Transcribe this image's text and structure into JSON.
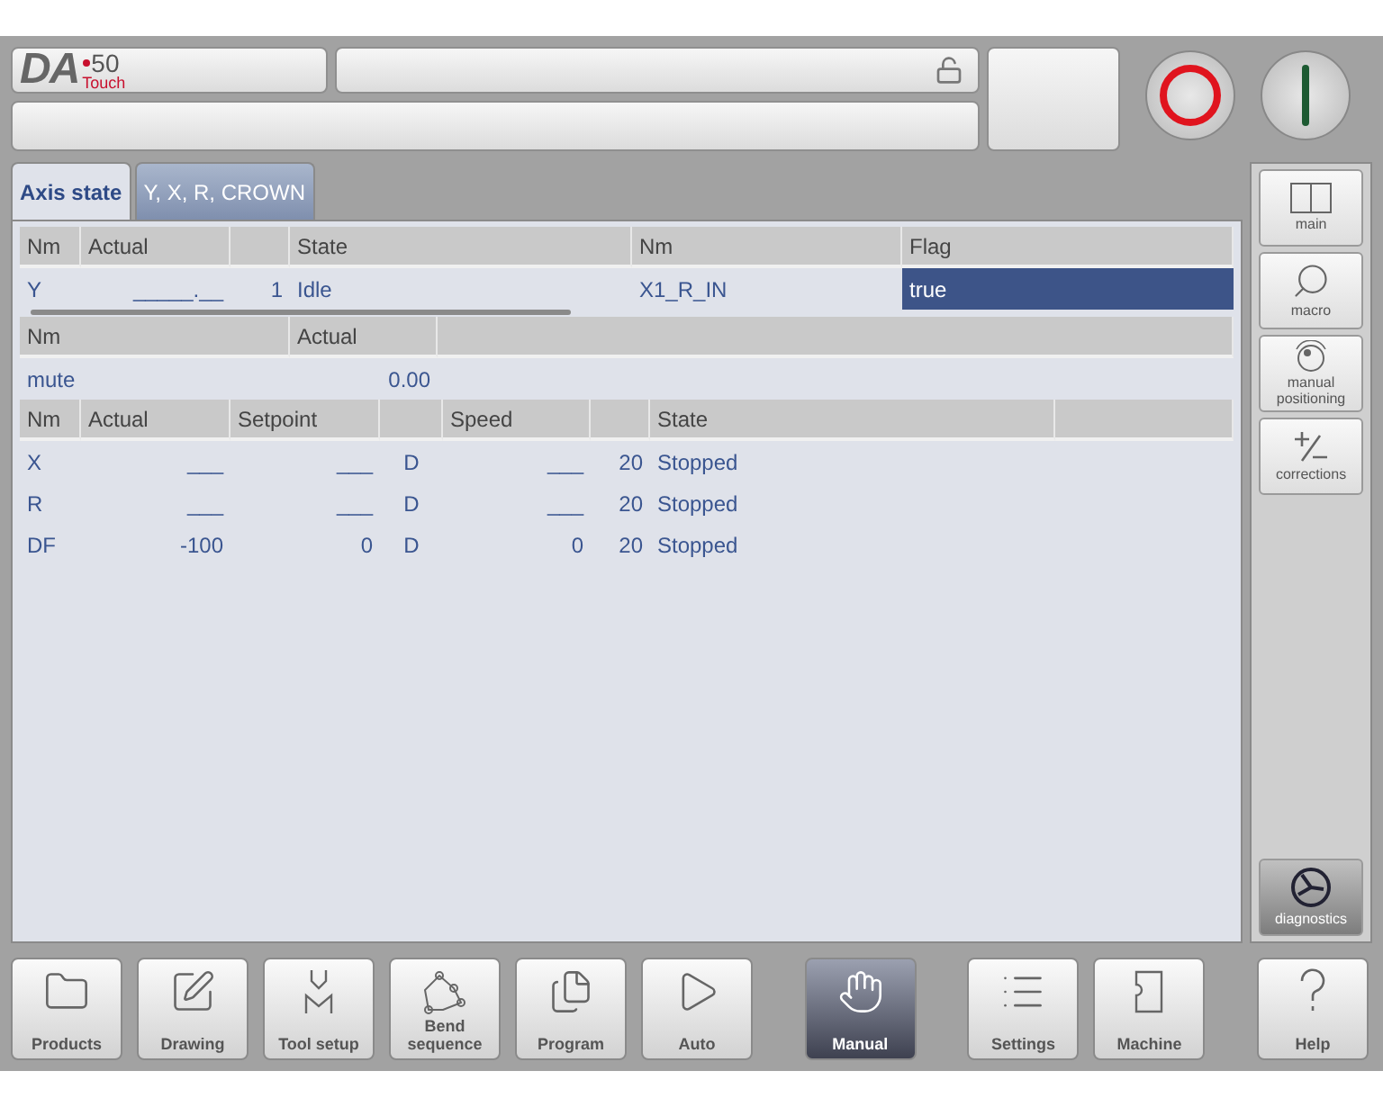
{
  "logo": {
    "brand": "DA",
    "model": "50",
    "edition": "Touch"
  },
  "header": {
    "locked": false
  },
  "tabs": [
    {
      "label": "Axis state",
      "selected": true
    },
    {
      "label": "Y, X, R, CROWN",
      "selected": false
    }
  ],
  "tables": [
    {
      "columns": [
        "Nm",
        "Actual",
        null,
        "State",
        "Nm",
        "Flag"
      ],
      "rows": [
        {
          "cells": [
            "Y",
            "_____.__",
            "1",
            "Idle",
            "X1_R_IN",
            {
              "text": "true",
              "selected": true
            }
          ]
        }
      ]
    },
    {
      "columns": [
        "Nm",
        "Actual",
        null
      ],
      "rows": [
        {
          "cells": [
            "mute",
            "0.00"
          ]
        }
      ]
    },
    {
      "columns": [
        "Nm",
        "Actual",
        "Setpoint",
        null,
        "Speed",
        null,
        "State",
        null
      ],
      "rows": [
        {
          "cells": [
            "X",
            "___",
            "___",
            "D",
            "___",
            "20",
            "Stopped"
          ]
        },
        {
          "cells": [
            "R",
            "___",
            "___",
            "D",
            "___",
            "20",
            "Stopped"
          ]
        },
        {
          "cells": [
            "DF",
            "-100",
            "0",
            "D",
            "0",
            "20",
            "Stopped"
          ]
        }
      ]
    }
  ],
  "side_buttons": [
    {
      "label": "main",
      "kind": "split",
      "selected": false
    },
    {
      "label": "macro",
      "kind": "search",
      "selected": false
    },
    {
      "label": "manual positioning",
      "kind": "knob",
      "selected": false
    },
    {
      "label": "corrections",
      "kind": "plusminus",
      "selected": false
    }
  ],
  "side_bottom": {
    "label": "diagnostics",
    "kind": "wheel",
    "selected": true
  },
  "nav_groups": [
    [
      {
        "label": "Products",
        "kind": "folder",
        "selected": false
      },
      {
        "label": "Drawing",
        "kind": "drawing",
        "selected": false
      },
      {
        "label": "Tool setup",
        "kind": "tool",
        "selected": false
      },
      {
        "label": "Bend sequence",
        "kind": "bend",
        "selected": false
      },
      {
        "label": "Program",
        "kind": "program",
        "selected": false
      },
      {
        "label": "Auto",
        "kind": "play",
        "selected": false
      }
    ],
    [
      {
        "label": "Manual",
        "kind": "hand",
        "selected": true
      }
    ],
    [
      {
        "label": "Settings",
        "kind": "list",
        "selected": false
      },
      {
        "label": "Machine",
        "kind": "machine",
        "selected": false
      }
    ],
    [
      {
        "label": "Help",
        "kind": "help",
        "selected": false
      }
    ]
  ]
}
